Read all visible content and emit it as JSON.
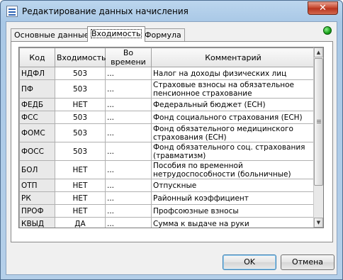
{
  "window": {
    "title": "Редактирование данных начисления",
    "close_glyph": "✕"
  },
  "tabs": [
    {
      "label": "Основные данные",
      "active": false
    },
    {
      "label": "Входимость",
      "active": true
    },
    {
      "label": "Формула",
      "active": false
    }
  ],
  "status_color": "#18a018",
  "table": {
    "columns": [
      "Код",
      "Входимость",
      "Во времени",
      "Комментарий"
    ],
    "rows": [
      {
        "code": "НДФЛ",
        "inclusion": "503",
        "time": "...",
        "comment": "Налог на доходы физических лиц",
        "tall": false
      },
      {
        "code": "ПФ",
        "inclusion": "503",
        "time": "...",
        "comment": "Страховые взносы на обязательное пенсионное страхование",
        "tall": true
      },
      {
        "code": "ФЕДБ",
        "inclusion": "НЕТ",
        "time": "...",
        "comment": "Федеральный бюджет (ЕСН)",
        "tall": false
      },
      {
        "code": "ФСС",
        "inclusion": "503",
        "time": "...",
        "comment": "Фонд социального страхования (ЕСН)",
        "tall": false
      },
      {
        "code": "ФОМС",
        "inclusion": "503",
        "time": "...",
        "comment": "Фонд обязательного медицинского страхования (ЕСН)",
        "tall": true
      },
      {
        "code": "ФОСС",
        "inclusion": "503",
        "time": "...",
        "comment": "Фонд обязательного соц. страхования (травматизм)",
        "tall": true
      },
      {
        "code": "БОЛ",
        "inclusion": "НЕТ",
        "time": "...",
        "comment": "Пособия по временной нетрудоспособности (больничные)",
        "tall": true
      },
      {
        "code": "ОТП",
        "inclusion": "НЕТ",
        "time": "...",
        "comment": "Отпускные",
        "tall": false
      },
      {
        "code": "РК",
        "inclusion": "НЕТ",
        "time": "...",
        "comment": "Районный коэффициент",
        "tall": false
      },
      {
        "code": "ПРОФ",
        "inclusion": "НЕТ",
        "time": "...",
        "comment": "Профсоюзные взносы",
        "tall": false
      },
      {
        "code": "КВЫД",
        "inclusion": "ДА",
        "time": "...",
        "comment": "Сумма к выдаче на руки",
        "tall": false
      }
    ]
  },
  "scrollbar": {
    "up": "▲",
    "down": "▼"
  },
  "buttons": {
    "ok": "OK",
    "cancel": "Отмена"
  }
}
